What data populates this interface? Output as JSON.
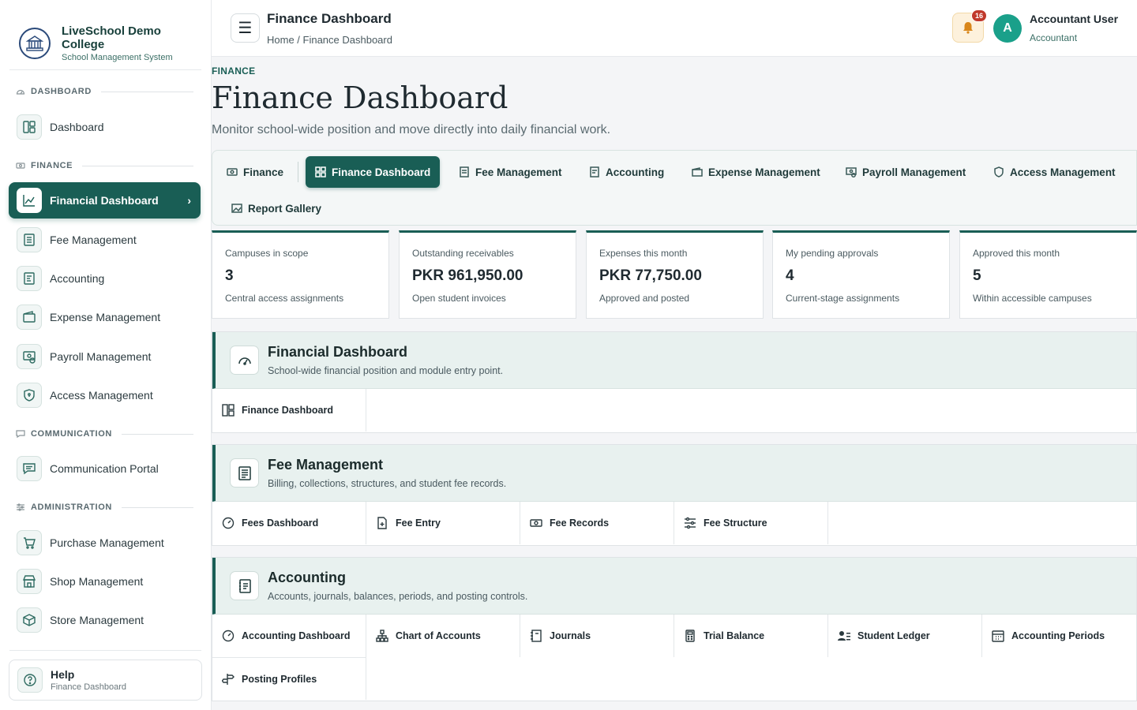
{
  "brand": {
    "name": "LiveSchool Demo College",
    "subtitle": "School Management System"
  },
  "sidebar": {
    "sections": [
      {
        "label": "DASHBOARD"
      },
      {
        "label": "FINANCE"
      },
      {
        "label": "COMMUNICATION"
      },
      {
        "label": "ADMINISTRATION"
      }
    ],
    "items": [
      {
        "label": "Dashboard",
        "icon": "layout-icon"
      },
      {
        "label": "Financial Dashboard",
        "icon": "chart-line-icon",
        "active": true
      },
      {
        "label": "Fee Management",
        "icon": "receipt-icon"
      },
      {
        "label": "Accounting",
        "icon": "ledger-icon"
      },
      {
        "label": "Expense Management",
        "icon": "wallet-icon"
      },
      {
        "label": "Payroll Management",
        "icon": "payroll-icon"
      },
      {
        "label": "Access Management",
        "icon": "shield-icon"
      },
      {
        "label": "Communication Portal",
        "icon": "message-icon"
      },
      {
        "label": "Purchase Management",
        "icon": "cart-icon"
      },
      {
        "label": "Shop Management",
        "icon": "store-icon"
      },
      {
        "label": "Store Management",
        "icon": "box-icon"
      }
    ],
    "help": {
      "title": "Help",
      "subtitle": "Finance Dashboard"
    }
  },
  "header": {
    "title": "Finance Dashboard",
    "breadcrumb": "Home / Finance Dashboard",
    "notifications": "16",
    "avatar_letter": "A",
    "user_name": "Accountant User",
    "user_role": "Accountant"
  },
  "page": {
    "eyebrow": "FINANCE",
    "title": "Finance Dashboard",
    "subtitle": "Monitor school-wide position and move directly into daily financial work."
  },
  "tabs": [
    {
      "label": "Finance"
    },
    {
      "label": "Finance Dashboard",
      "active": true
    },
    {
      "label": "Fee Management"
    },
    {
      "label": "Accounting"
    },
    {
      "label": "Expense Management"
    },
    {
      "label": "Payroll Management"
    },
    {
      "label": "Access Management"
    },
    {
      "label": "Report Gallery"
    }
  ],
  "stats": [
    {
      "label": "Campuses in scope",
      "value": "3",
      "note": "Central access assignments"
    },
    {
      "label": "Outstanding receivables",
      "value": "PKR 961,950.00",
      "note": "Open student invoices"
    },
    {
      "label": "Expenses this month",
      "value": "PKR 77,750.00",
      "note": "Approved and posted"
    },
    {
      "label": "My pending approvals",
      "value": "4",
      "note": "Current-stage assignments"
    },
    {
      "label": "Approved this month",
      "value": "5",
      "note": "Within accessible campuses"
    }
  ],
  "modules": [
    {
      "title": "Financial Dashboard",
      "subtitle": "School-wide financial position and module entry point.",
      "links": [
        {
          "label": "Finance Dashboard"
        }
      ]
    },
    {
      "title": "Fee Management",
      "subtitle": "Billing, collections, structures, and student fee records.",
      "links": [
        {
          "label": "Fees Dashboard"
        },
        {
          "label": "Fee Entry"
        },
        {
          "label": "Fee Records"
        },
        {
          "label": "Fee Structure"
        }
      ]
    },
    {
      "title": "Accounting",
      "subtitle": "Accounts, journals, balances, periods, and posting controls.",
      "links": [
        {
          "label": "Accounting Dashboard"
        },
        {
          "label": "Chart of Accounts"
        },
        {
          "label": "Journals"
        },
        {
          "label": "Trial Balance"
        },
        {
          "label": "Student Ledger"
        },
        {
          "label": "Accounting Periods"
        },
        {
          "label": "Posting Profiles"
        }
      ]
    }
  ],
  "colors": {
    "accent": "#195e55",
    "accent_light": "#e8f1ef",
    "bell_bg": "#fdf1dc",
    "badge": "#c0392b",
    "avatar": "#1aa08a"
  }
}
